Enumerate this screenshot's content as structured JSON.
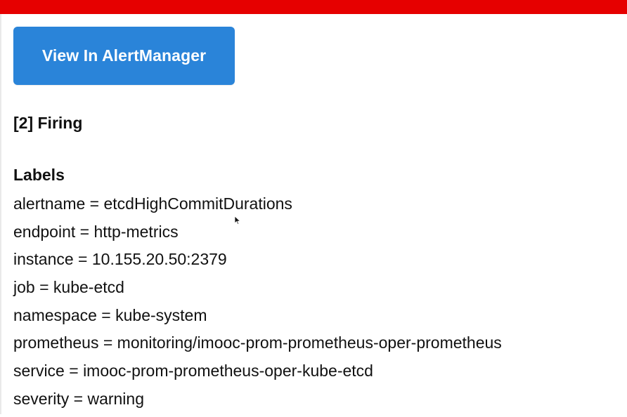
{
  "header": {
    "accent_color": "#e60000"
  },
  "button": {
    "label": "View In AlertManager",
    "color": "#2a84d9"
  },
  "alert": {
    "firing_text": "[2] Firing",
    "labels_title": "Labels",
    "labels": [
      "alertname = etcdHighCommitDurations",
      "endpoint = http-metrics",
      "instance = 10.155.20.50:2379",
      "job = kube-etcd",
      "namespace = kube-system",
      "prometheus = monitoring/imooc-prom-prometheus-oper-prometheus",
      "service = imooc-prom-prometheus-oper-kube-etcd",
      "severity = warning"
    ]
  },
  "icons": {
    "cursor": "mouse-cursor-icon"
  }
}
